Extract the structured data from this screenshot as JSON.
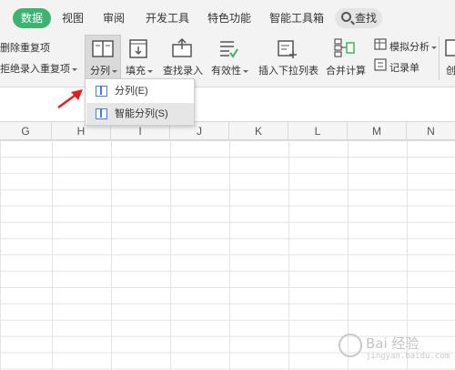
{
  "tabs": {
    "data": "数据",
    "view": "视图",
    "review": "审阅",
    "developer": "开发工具",
    "special": "特色功能",
    "smart_toolbox": "智能工具箱",
    "search": "查找"
  },
  "ribbon": {
    "remove_duplicates": "删除重复项",
    "reject_duplicates": "拒绝录入重复项",
    "split_column": "分列",
    "fill": "填充",
    "find_entry": "查找录入",
    "validity": "有效性",
    "insert_dropdown": "插入下拉列表",
    "merge_calc": "合并计算",
    "simulation": "模拟分析",
    "record_form": "记录单",
    "create": "创"
  },
  "dropdown": {
    "item_split": "分列(E)",
    "item_smart_split": "智能分列(S)"
  },
  "columns": [
    "G",
    "H",
    "I",
    "J",
    "K",
    "L",
    "M",
    "N"
  ],
  "watermark": {
    "text": "Bai 经验",
    "url": "jingyan.baidu.com"
  },
  "colors": {
    "active_tab": "#3cb371",
    "arrow": "#e02020"
  }
}
